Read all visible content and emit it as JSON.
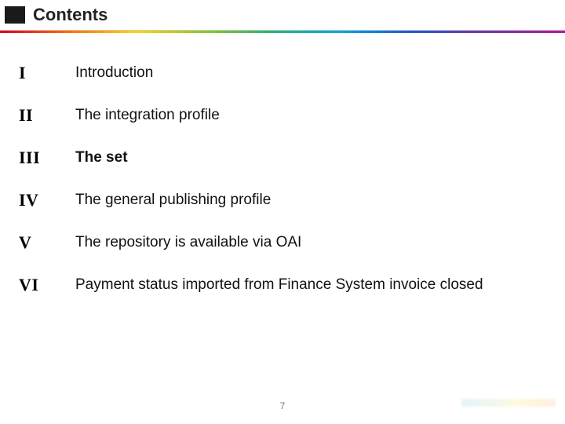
{
  "header": {
    "title": "Contents"
  },
  "toc": {
    "items": [
      {
        "numeral": "I",
        "label": "Introduction"
      },
      {
        "numeral": "II",
        "label": "The integration profile"
      },
      {
        "numeral": "III",
        "label": "The set"
      },
      {
        "numeral": "IV",
        "label": "The general publishing profile"
      },
      {
        "numeral": "V",
        "label": "The repository is available via OAI"
      },
      {
        "numeral": "VI",
        "label": "Payment status imported from Finance System invoice closed"
      }
    ],
    "bold_index": 2
  },
  "footer": {
    "page_number": "7"
  }
}
